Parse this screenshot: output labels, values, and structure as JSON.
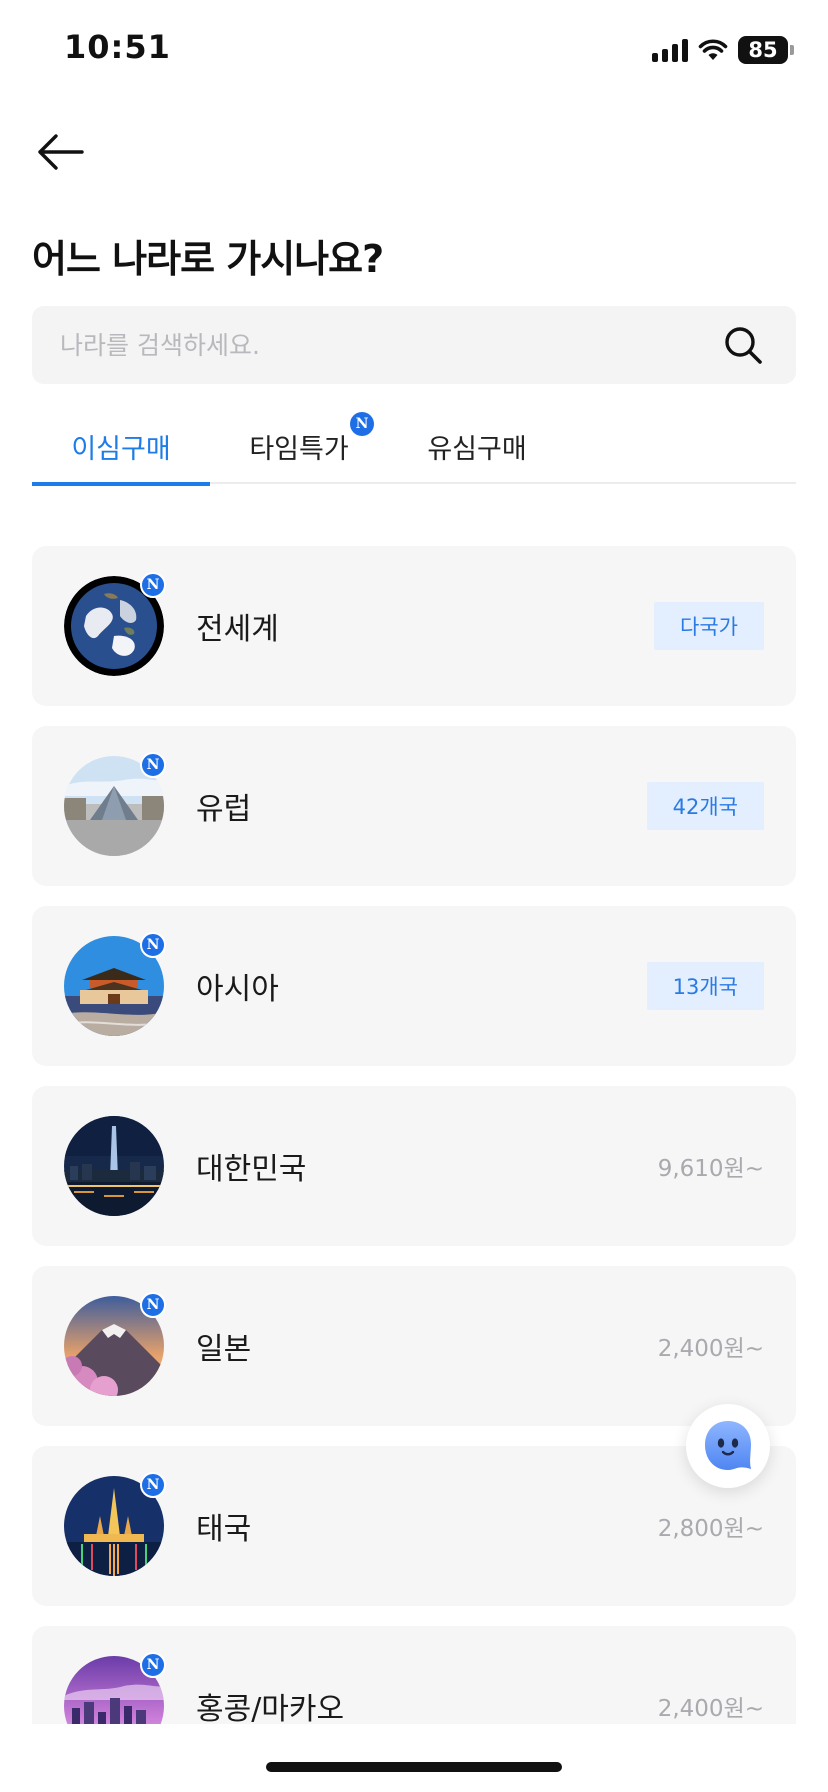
{
  "status_bar": {
    "time": "10:51",
    "battery": "85",
    "icons": [
      "signal-icon",
      "wifi-icon",
      "battery-icon"
    ]
  },
  "header": {
    "back_icon": "arrow-left-icon",
    "title": "어느 나라로 가시나요?"
  },
  "search": {
    "placeholder": "나라를 검색하세요.",
    "value": "",
    "icon": "search-icon"
  },
  "tabs": [
    {
      "label": "이심구매",
      "active": true,
      "new_badge": false
    },
    {
      "label": "타임특가",
      "active": false,
      "new_badge": true,
      "badge_text": "N"
    },
    {
      "label": "유심구매",
      "active": false,
      "new_badge": false
    }
  ],
  "destinations": [
    {
      "name": "전세계",
      "tag": "다국가",
      "price": "",
      "new_badge": true,
      "badge_text": "N",
      "image": "earth-image"
    },
    {
      "name": "유럽",
      "tag": "42개국",
      "price": "",
      "new_badge": true,
      "badge_text": "N",
      "image": "louvre-pyramid-image"
    },
    {
      "name": "아시아",
      "tag": "13개국",
      "price": "",
      "new_badge": true,
      "badge_text": "N",
      "image": "palace-gate-image"
    },
    {
      "name": "대한민국",
      "tag": "",
      "price": "9,610원~",
      "new_badge": false,
      "badge_text": "",
      "image": "seoul-night-skyline-image"
    },
    {
      "name": "일본",
      "tag": "",
      "price": "2,400원~",
      "new_badge": true,
      "badge_text": "N",
      "image": "mount-fuji-image"
    },
    {
      "name": "태국",
      "tag": "",
      "price": "2,800원~",
      "new_badge": true,
      "badge_text": "N",
      "image": "temple-of-dawn-image"
    },
    {
      "name": "홍콩/마카오",
      "tag": "",
      "price": "2,400원~",
      "new_badge": true,
      "badge_text": "N",
      "image": "hong-kong-skyline-image"
    }
  ],
  "chatbot": {
    "icon": "chatbot-icon"
  },
  "colors": {
    "accent": "#1e7ce8",
    "badge": "#1e6fe6",
    "tag_bg": "#e3efff",
    "tag_text": "#2a7ae4",
    "card_bg": "#f6f6f7",
    "price_text": "#a9a9ae"
  }
}
